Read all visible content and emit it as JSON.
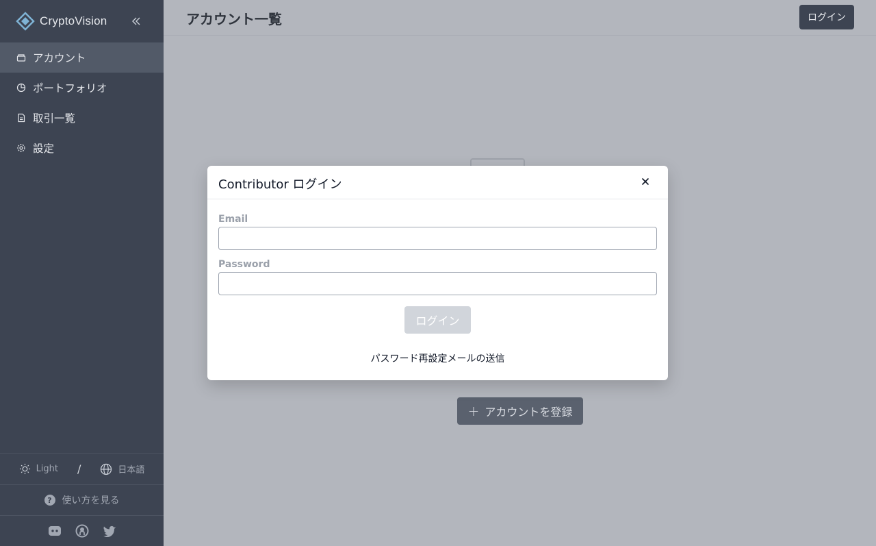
{
  "app": {
    "brand": "CryptoVision"
  },
  "sidebar": {
    "items": [
      {
        "label": "アカウント",
        "icon": "wallet-icon",
        "active": true
      },
      {
        "label": "ポートフォリオ",
        "icon": "pie-chart-icon",
        "active": false
      },
      {
        "label": "取引一覧",
        "icon": "document-icon",
        "active": false
      },
      {
        "label": "設定",
        "icon": "gear-icon",
        "active": false
      }
    ],
    "footer": {
      "theme_label": "Light",
      "separator": "/",
      "language_label": "日本語",
      "help_label": "使い方を見る",
      "social": [
        "discord-icon",
        "github-icon",
        "twitter-icon"
      ]
    }
  },
  "header": {
    "title": "アカウント一覧",
    "login_label": "ログイン"
  },
  "main": {
    "register_label": "アカウントを登録",
    "register_icon": "+"
  },
  "modal": {
    "title": "Contributor ログイン",
    "email_label": "Email",
    "email_value": "",
    "password_label": "Password",
    "password_value": "",
    "login_label": "ログイン",
    "reset_link": "パスワード再設定メールの送信"
  },
  "colors": {
    "sidebar_bg": "#3d4452",
    "sidebar_active": "#525a68",
    "main_bg": "#b3b6bd",
    "button_dark": "#3d4452",
    "button_disabled": "#d1d5db"
  }
}
